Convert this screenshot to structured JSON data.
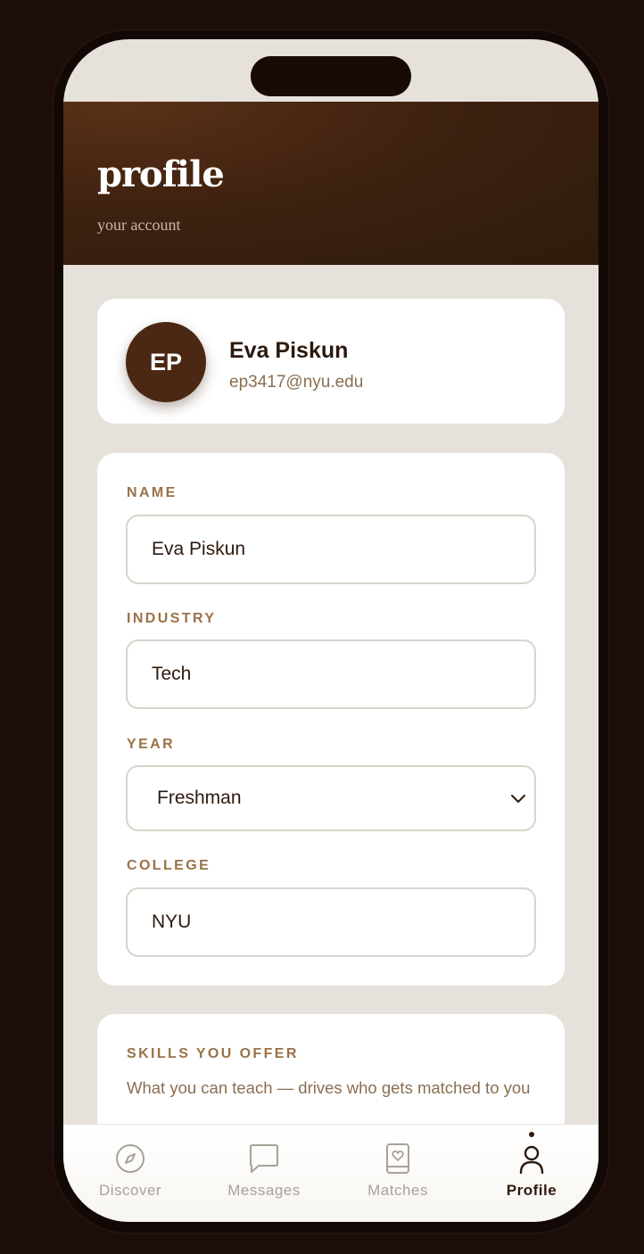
{
  "header": {
    "title": "profile",
    "subtitle": "your account"
  },
  "profile": {
    "initials": "EP",
    "name": "Eva Piskun",
    "email": "ep3417@nyu.edu"
  },
  "form": {
    "name_label": "NAME",
    "name_value": "Eva Piskun",
    "industry_label": "INDUSTRY",
    "industry_value": "Tech",
    "year_label": "YEAR",
    "year_value": "Freshman",
    "college_label": "COLLEGE",
    "college_value": "NYU"
  },
  "skills": {
    "label": "SKILLS YOU OFFER",
    "subtitle": "What you can teach — drives who gets matched to you"
  },
  "tabs": [
    {
      "label": "Discover",
      "icon": "compass-icon",
      "active": false
    },
    {
      "label": "Messages",
      "icon": "chat-bubble-icon",
      "active": false
    },
    {
      "label": "Matches",
      "icon": "heart-book-icon",
      "active": false
    },
    {
      "label": "Profile",
      "icon": "person-icon",
      "active": true
    }
  ],
  "colors": {
    "background": "#1c0d08",
    "screen": "#e6e1da",
    "header_brown": "#3f2210",
    "accent_label": "#9a7248",
    "text_dark": "#2c1a0e",
    "avatar": "#4a2814"
  }
}
